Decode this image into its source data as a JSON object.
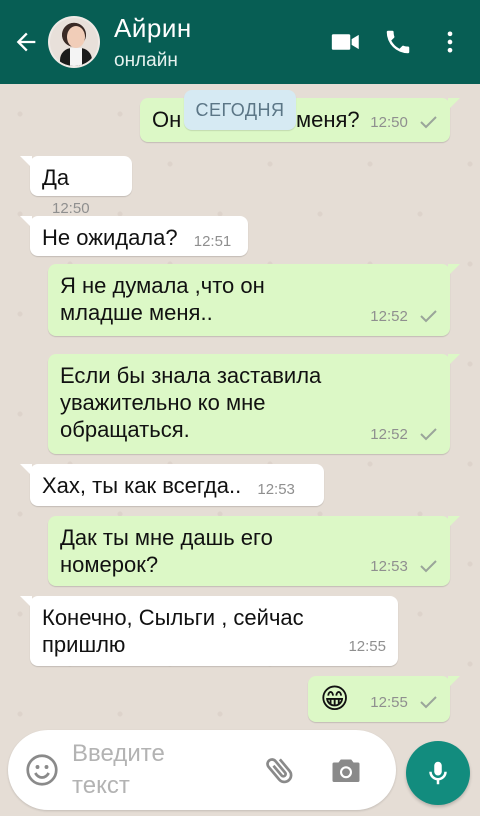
{
  "header": {
    "contact_name": "Айрин",
    "status": "онлайн"
  },
  "date_chip": "СЕГОДНЯ",
  "messages": [
    {
      "direction": "out",
      "text": "Он младше меня?",
      "visible_text": "Он",
      "visible_text_after": "меня?",
      "time": "12:50",
      "ticks": "single"
    },
    {
      "direction": "in",
      "text": "Да",
      "time": "12:50"
    },
    {
      "direction": "in",
      "text": "Не ожидала?",
      "time": "12:51"
    },
    {
      "direction": "out",
      "line1": "Я не думала ,что он",
      "line2": "младше меня..",
      "time": "12:52",
      "ticks": "single"
    },
    {
      "direction": "out",
      "line1": "Если бы знала заставила",
      "line2": "уважительно ко мне",
      "line3": "обращаться.",
      "time": "12:52",
      "ticks": "single"
    },
    {
      "direction": "in",
      "text": "Хах, ты как всегда..",
      "time": "12:53"
    },
    {
      "direction": "out",
      "line1": "Дак ты мне дашь его",
      "line2": "номерок?",
      "time": "12:53",
      "ticks": "single"
    },
    {
      "direction": "in",
      "line1": "Конечно, Сыльги , сейчас",
      "line2": "пришлю",
      "time": "12:55"
    },
    {
      "direction": "out",
      "text": "😁",
      "time": "12:55",
      "ticks": "single"
    }
  ],
  "input": {
    "placeholder_line1": "Введите",
    "placeholder_line2": "текст"
  },
  "icons": {
    "back": "arrow-left-icon",
    "video": "video-camera-icon",
    "call": "phone-icon",
    "menu": "more-vertical-icon",
    "emoji": "smiley-icon",
    "attach": "paperclip-icon",
    "camera": "camera-icon",
    "mic": "microphone-icon"
  },
  "colors": {
    "header": "#075e54",
    "outgoing_bubble": "#dcf8c6",
    "incoming_bubble": "#ffffff",
    "mic_button": "#128c7e",
    "chat_background": "#e5ddd5"
  }
}
